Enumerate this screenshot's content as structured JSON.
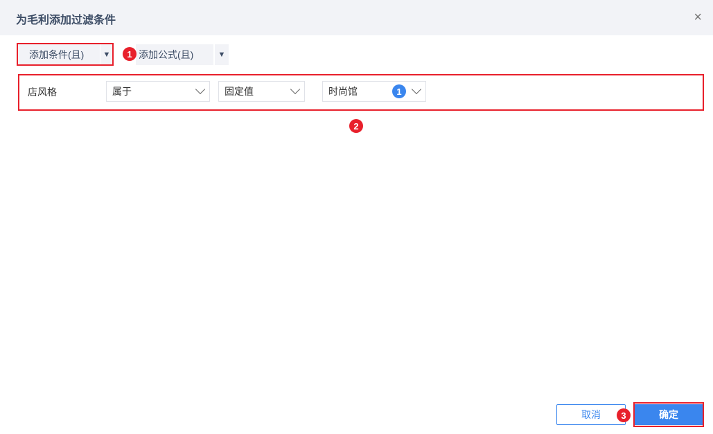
{
  "dialog": {
    "title": "为毛利添加过滤条件",
    "close": "×"
  },
  "toolbar": {
    "add_condition": "添加条件(且)",
    "add_formula": "添加公式(且)",
    "dropdown_arrow": "▼"
  },
  "condition": {
    "field": "店风格",
    "operator": "属于",
    "value_type": "固定值",
    "value": "时尚馆",
    "selected_count": "1"
  },
  "steps": [
    "1",
    "2",
    "3"
  ],
  "footer": {
    "cancel": "取消",
    "confirm": "确定"
  },
  "colors": {
    "accent": "#3a86ee",
    "highlight": "#e8202b"
  }
}
